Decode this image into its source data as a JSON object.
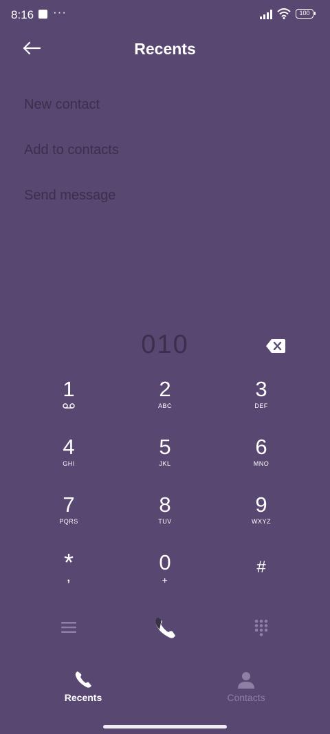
{
  "status_bar": {
    "time": "8:16",
    "dots": "···",
    "battery": "100"
  },
  "header": {
    "title": "Recents"
  },
  "actions": [
    {
      "label": "New contact"
    },
    {
      "label": "Add to contacts"
    },
    {
      "label": "Send message"
    }
  ],
  "dialer": {
    "number": "010"
  },
  "keypad": [
    {
      "digit": "1",
      "letters": ""
    },
    {
      "digit": "2",
      "letters": "ABC"
    },
    {
      "digit": "3",
      "letters": "DEF"
    },
    {
      "digit": "4",
      "letters": "GHI"
    },
    {
      "digit": "5",
      "letters": "JKL"
    },
    {
      "digit": "6",
      "letters": "MNO"
    },
    {
      "digit": "7",
      "letters": "PQRS"
    },
    {
      "digit": "8",
      "letters": "TUV"
    },
    {
      "digit": "9",
      "letters": "WXYZ"
    },
    {
      "digit": "*",
      "letters": ","
    },
    {
      "digit": "0",
      "letters": "+"
    },
    {
      "digit": "#",
      "letters": ""
    }
  ],
  "bottom_nav": {
    "recents_label": "Recents",
    "contacts_label": "Contacts"
  },
  "colors": {
    "background": "#584770",
    "muted_text": "#3a2f4c",
    "inactive_nav": "#8e7fa5"
  }
}
